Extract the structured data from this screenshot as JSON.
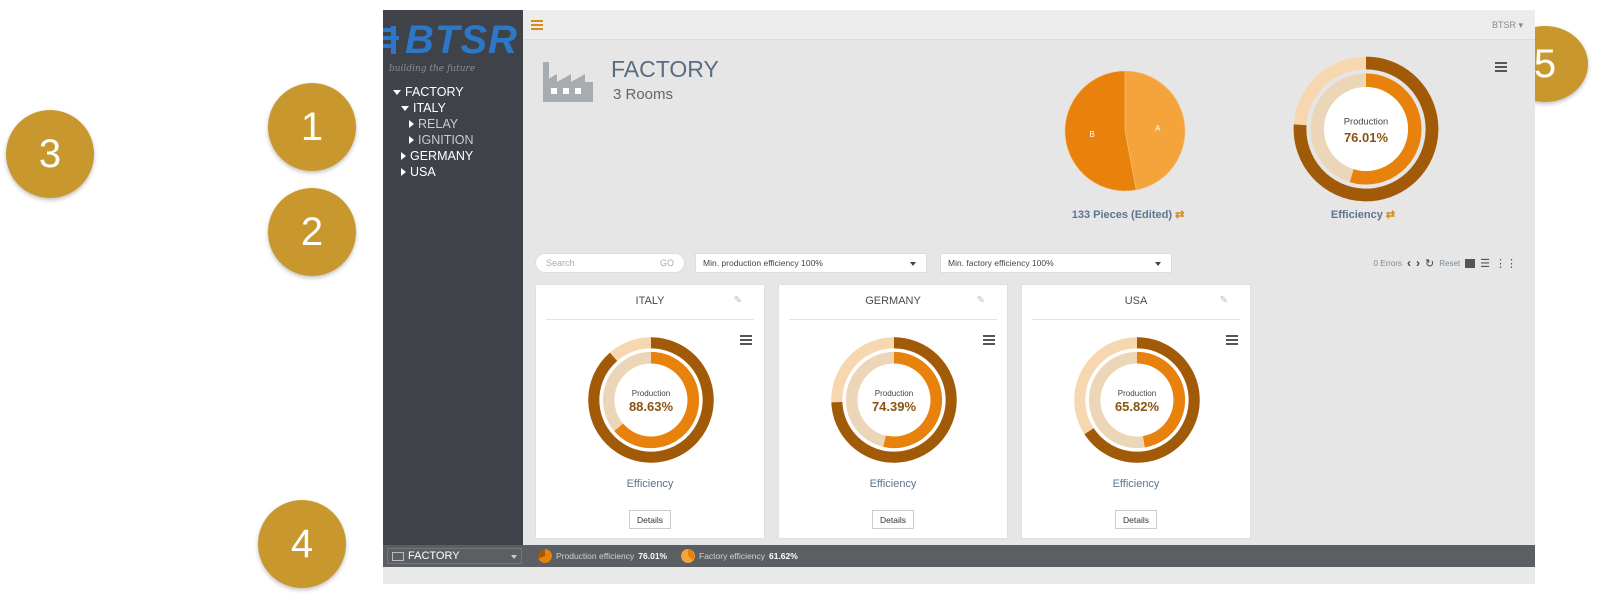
{
  "callouts": [
    {
      "label": "1"
    },
    {
      "label": "2"
    },
    {
      "label": "3"
    },
    {
      "label": "4"
    },
    {
      "label": "5"
    }
  ],
  "logo": {
    "text": "BTSR",
    "tagline": "building the future"
  },
  "tree": {
    "root": "FACTORY",
    "italy": "ITALY",
    "relay": "RELAY",
    "ignition": "IGNITION",
    "germany": "GERMANY",
    "usa": "USA"
  },
  "topbar": {
    "user": "BTSR ▾"
  },
  "header": {
    "title": "FACTORY",
    "subtitle": "3 Rooms"
  },
  "chart_data": [
    {
      "type": "pie",
      "categories": [
        "A",
        "B"
      ],
      "values": [
        47,
        53
      ],
      "colors": [
        "#f5a43c",
        "#e8820c"
      ],
      "title": "133 Pieces (Edited)"
    },
    {
      "type": "pie",
      "title": "Efficiency",
      "center_label": "Production",
      "center_value": "76.01%",
      "production": 76.01
    },
    {
      "type": "pie",
      "title": "ITALY",
      "center_label": "Production",
      "center_value": "88.63%",
      "production": 88.63
    },
    {
      "type": "pie",
      "title": "GERMANY",
      "center_label": "Production",
      "center_value": "74.39%",
      "production": 74.39
    },
    {
      "type": "pie",
      "title": "USA",
      "center_label": "Production",
      "center_value": "65.82%",
      "production": 65.82
    }
  ],
  "summary": {
    "pieces_caption": "133 Pieces (Edited)",
    "efficiency_caption": "Efficiency",
    "production_label": "Production",
    "production_value": "76.01%"
  },
  "controls": {
    "search_placeholder": "Search",
    "go_label": "GO",
    "prod_filter": "Min. production efficiency 100%",
    "fact_filter": "Min. factory efficiency 100%",
    "errors": "0 Errors",
    "reset": "Reset"
  },
  "cards": [
    {
      "title": "ITALY",
      "production_label": "Production",
      "value": "88.63%",
      "efficiency_label": "Efficiency",
      "details": "Details"
    },
    {
      "title": "GERMANY",
      "production_label": "Production",
      "value": "74.39%",
      "efficiency_label": "Efficiency",
      "details": "Details"
    },
    {
      "title": "USA",
      "production_label": "Production",
      "value": "65.82%",
      "efficiency_label": "Efficiency",
      "details": "Details"
    }
  ],
  "statusbar": {
    "selected": "FACTORY",
    "prod_label": "Production efficiency",
    "prod_value": "76.01%",
    "fact_label": "Factory efficiency",
    "fact_value": "61.62%"
  },
  "colors": {
    "accent": "#d98b1a",
    "dark_orange": "#a15a08",
    "mid_orange": "#e8820c",
    "light_orange": "#f5a43c",
    "pale": "#f6d7b0",
    "callout": "#c8982e"
  }
}
